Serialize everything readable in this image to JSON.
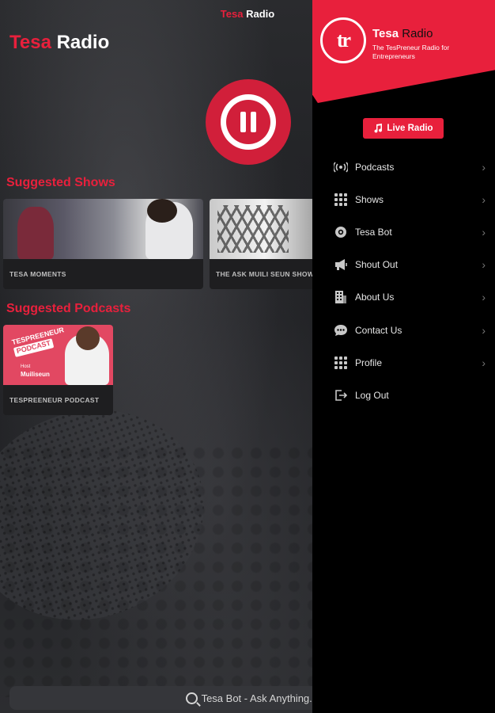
{
  "status_title": {
    "brand": "Tesa",
    "rest": "Radio"
  },
  "app_title": {
    "brand": "Tesa",
    "rest": "Radio"
  },
  "player": {
    "state_icon": "pause-icon"
  },
  "suggested_shows": {
    "title": "Suggested Shows",
    "items": [
      {
        "caption": "TESA MOMENTS"
      },
      {
        "caption": "THE ASK MUILI SEUN SHOW"
      }
    ]
  },
  "suggested_podcasts": {
    "title": "Suggested Podcasts",
    "items": [
      {
        "caption": "TESPREENEUR PODCAST",
        "thumb_title": "TESPREENEUR",
        "thumb_word": "PODCAST",
        "thumb_host_label": "Host",
        "thumb_host": "Muiliseun"
      }
    ]
  },
  "search": {
    "placeholder": "Tesa Bot - Ask Anything..."
  },
  "drawer": {
    "logo_text": "tr",
    "title_brand": "Tesa",
    "title_rest": "Radio",
    "subtitle": "The TesPreneur Radio for Entrepreneurs",
    "live_button": "Live Radio",
    "menu": [
      {
        "label": "Podcasts",
        "icon": "broadcast-icon",
        "chevron": true
      },
      {
        "label": "Shows",
        "icon": "grid-icon",
        "chevron": true
      },
      {
        "label": "Tesa Bot",
        "icon": "bot-icon",
        "chevron": true
      },
      {
        "label": "Shout Out",
        "icon": "megaphone-icon",
        "chevron": true
      },
      {
        "label": "About Us",
        "icon": "building-icon",
        "chevron": true
      },
      {
        "label": "Contact Us",
        "icon": "chat-icon",
        "chevron": true
      },
      {
        "label": "Profile",
        "icon": "profile-grid-icon",
        "chevron": true
      },
      {
        "label": "Log Out",
        "icon": "logout-icon",
        "chevron": false
      }
    ]
  },
  "colors": {
    "accent": "#e8203c",
    "background": "#000000",
    "card": "#1e1e20"
  }
}
